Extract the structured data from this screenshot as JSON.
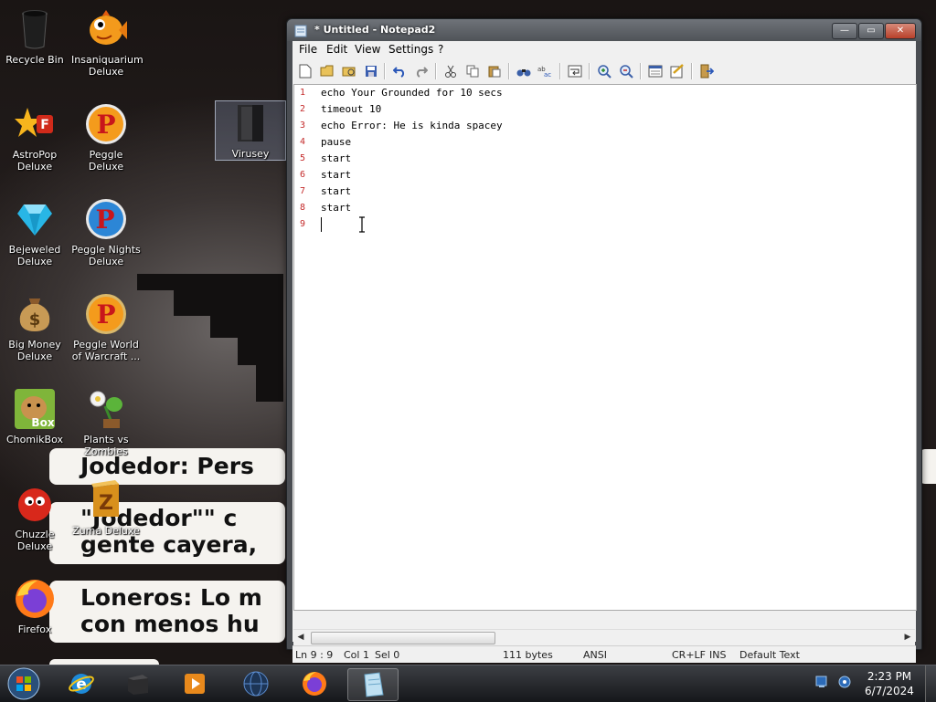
{
  "desktop": {
    "icons": [
      {
        "label": "Recycle Bin",
        "icon": "recycle-bin-icon"
      },
      {
        "label": "Insaniquarium Deluxe",
        "icon": "insaniquarium-icon"
      },
      {
        "label": "AstroPop Deluxe",
        "icon": "astropop-icon"
      },
      {
        "label": "Peggle Deluxe",
        "icon": "peggle-icon"
      },
      {
        "label": "Bejeweled Deluxe",
        "icon": "bejeweled-icon"
      },
      {
        "label": "Peggle Nights Deluxe",
        "icon": "peggle-nights-icon"
      },
      {
        "label": "Big Money Deluxe",
        "icon": "big-money-icon"
      },
      {
        "label": "Peggle World of Warcraft ...",
        "icon": "peggle-wow-icon"
      },
      {
        "label": "ChomikBox",
        "icon": "chomikbox-icon"
      },
      {
        "label": "Plants vs Zombies",
        "icon": "plants-vs-zombies-icon"
      },
      {
        "label": "Chuzzle Deluxe",
        "icon": "chuzzle-icon"
      },
      {
        "label": "Zuma Deluxe",
        "icon": "zuma-icon"
      },
      {
        "label": "Firefox",
        "icon": "firefox-icon"
      },
      {
        "label": "Virusey",
        "icon": "file-icon"
      }
    ],
    "wallpaper_text": {
      "line1": "Jodedor: Pers",
      "line2a": "\"Jodedor\"\" c",
      "line2b": "gente cayera,",
      "line3a": "Loneros: Lo m",
      "line3b": "con menos hu"
    }
  },
  "window": {
    "title": "* Untitled - Notepad2",
    "controls": {
      "minimize": "—",
      "maximize": "▭",
      "close": "✕"
    },
    "menu": [
      "File",
      "Edit",
      "View",
      "Settings",
      "?"
    ],
    "toolbar_icons": [
      "new-file-icon",
      "open-file-icon",
      "browse-icon",
      "save-icon",
      "undo-icon",
      "redo-icon",
      "cut-icon",
      "copy-icon",
      "paste-icon",
      "find-icon",
      "replace-icon",
      "word-wrap-icon",
      "zoom-in-icon",
      "zoom-out-icon",
      "scheme-icon",
      "customize-icon",
      "exit-icon"
    ],
    "editor": {
      "lines": [
        {
          "num": "1",
          "text": "echo Your Grounded for 10 secs"
        },
        {
          "num": "2",
          "text": "timeout 10"
        },
        {
          "num": "3",
          "text": "echo Error: He is kinda spacey"
        },
        {
          "num": "4",
          "text": "pause"
        },
        {
          "num": "5",
          "text": "start"
        },
        {
          "num": "6",
          "text": "start"
        },
        {
          "num": "7",
          "text": "start"
        },
        {
          "num": "8",
          "text": "start"
        },
        {
          "num": "9",
          "text": ""
        }
      ]
    },
    "status": {
      "position": "Ln 9 : 9",
      "column": "Col 1",
      "selection": "Sel 0",
      "size": "111 bytes",
      "encoding": "ANSI",
      "line_endings": "CR+LF",
      "insert_mode": "INS",
      "scheme": "Default Text"
    }
  },
  "taskbar": {
    "pinned": [
      "internet-explorer-icon",
      "app-box-icon",
      "media-player-icon",
      "network-globe-icon",
      "firefox-icon",
      "notepad2-icon"
    ],
    "clock": {
      "time": "2:23 PM",
      "date": "6/7/2024"
    }
  },
  "colors": {
    "line_number": "#c42b2b",
    "accent": "#4f5358"
  }
}
